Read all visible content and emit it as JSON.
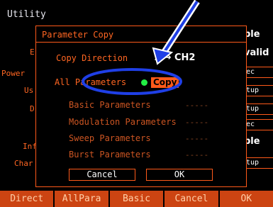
{
  "screen_title": "Utility",
  "background": {
    "left_labels": [
      "E",
      "Power",
      "Us",
      "D",
      "Inf",
      "Char"
    ],
    "right_items": [
      "ble",
      "valid",
      "ec",
      "tup",
      "tup",
      "ec",
      "ble",
      "tup"
    ]
  },
  "dialog": {
    "title": "Parameter Copy",
    "copy_direction_label": "Copy Direction",
    "copy_direction_value": "1 → CH2",
    "all_parameters_label": "All Parameters",
    "all_parameters_value": "Copy",
    "rows": [
      {
        "label": "Basic Parameters",
        "value": "-----"
      },
      {
        "label": "Modulation Parameters",
        "value": "-----"
      },
      {
        "label": "Sweep Parameters",
        "value": "-----"
      },
      {
        "label": "Burst Parameters",
        "value": "-----"
      }
    ],
    "cancel_label": "Cancel",
    "ok_label": "OK"
  },
  "softkeys": [
    "Direct",
    "AllPara",
    "Basic",
    "Cancel",
    "OK"
  ],
  "colors": {
    "accent": "#ff5a1a",
    "label": "#ff6622",
    "softkey_bg": "#cc4412",
    "led_on": "#22ee44",
    "annotation": "#1f3fe6"
  }
}
